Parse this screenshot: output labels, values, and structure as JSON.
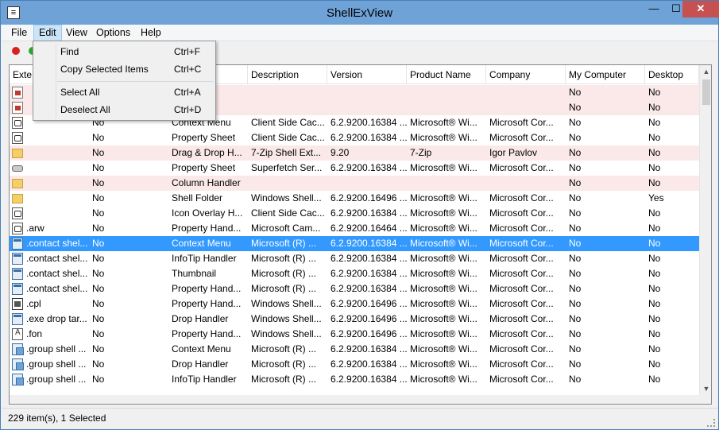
{
  "window": {
    "title": "ShellExView"
  },
  "titlebar": {
    "min_glyph": "—",
    "max_glyph": "☐",
    "close_glyph": "✕"
  },
  "menu": [
    "File",
    "Edit",
    "View",
    "Options",
    "Help"
  ],
  "edit_menu": [
    {
      "label": "Find",
      "shortcut": "Ctrl+F"
    },
    {
      "label": "Copy Selected Items",
      "shortcut": "Ctrl+C"
    },
    {
      "label": "Select All",
      "shortcut": "Ctrl+A"
    },
    {
      "label": "Deselect All",
      "shortcut": "Ctrl+D"
    }
  ],
  "columns": [
    "Exte",
    "",
    "",
    "Description",
    "Version",
    "Product Name",
    "Company",
    "My Computer",
    "Desktop"
  ],
  "rows": [
    {
      "icon": "red",
      "ext": "",
      "c2": "",
      "type": "ndler",
      "desc": "",
      "version": "",
      "product": "",
      "company": "",
      "mycomputer": "No",
      "desktop": "No",
      "style": "pink"
    },
    {
      "icon": "red",
      "ext": "",
      "c2": "",
      "type": "",
      "desc": "",
      "version": "",
      "product": "",
      "company": "",
      "mycomputer": "No",
      "desktop": "No",
      "style": "pink"
    },
    {
      "icon": "doc",
      "ext": "",
      "c2": "No",
      "type": "Context Menu",
      "desc": "Client Side Cac...",
      "version": "6.2.9200.16384 ...",
      "product": "Microsoft® Wi...",
      "company": "Microsoft Cor...",
      "mycomputer": "No",
      "desktop": "No",
      "style": ""
    },
    {
      "icon": "doc",
      "ext": "",
      "c2": "No",
      "type": "Property Sheet",
      "desc": "Client Side Cac...",
      "version": "6.2.9200.16384 ...",
      "product": "Microsoft® Wi...",
      "company": "Microsoft Cor...",
      "mycomputer": "No",
      "desktop": "No",
      "style": ""
    },
    {
      "icon": "folder",
      "ext": "",
      "c2": "No",
      "type": "Drag & Drop H...",
      "desc": "7-Zip Shell Ext...",
      "version": "9.20",
      "product": "7-Zip",
      "company": "Igor Pavlov",
      "mycomputer": "No",
      "desktop": "No",
      "style": "pink"
    },
    {
      "icon": "drive",
      "ext": "",
      "c2": "No",
      "type": "Property Sheet",
      "desc": "Superfetch Ser...",
      "version": "6.2.9200.16384 ...",
      "product": "Microsoft® Wi...",
      "company": "Microsoft Cor...",
      "mycomputer": "No",
      "desktop": "No",
      "style": ""
    },
    {
      "icon": "folder",
      "ext": "",
      "c2": "No",
      "type": "Column Handler",
      "desc": "",
      "version": "",
      "product": "",
      "company": "",
      "mycomputer": "No",
      "desktop": "No",
      "style": "pink"
    },
    {
      "icon": "folder",
      "ext": "",
      "c2": "No",
      "type": "Shell Folder",
      "desc": "Windows Shell...",
      "version": "6.2.9200.16496 ...",
      "product": "Microsoft® Wi...",
      "company": "Microsoft Cor...",
      "mycomputer": "No",
      "desktop": "Yes",
      "style": ""
    },
    {
      "icon": "doc",
      "ext": "",
      "c2": "No",
      "type": "Icon Overlay H...",
      "desc": "Client Side Cac...",
      "version": "6.2.9200.16384 ...",
      "product": "Microsoft® Wi...",
      "company": "Microsoft Cor...",
      "mycomputer": "No",
      "desktop": "No",
      "style": ""
    },
    {
      "icon": "doc",
      "ext": ".arw",
      "c2": "No",
      "type": "Property Hand...",
      "desc": "Microsoft Cam...",
      "version": "6.2.9200.16464 ...",
      "product": "Microsoft® Wi...",
      "company": "Microsoft Cor...",
      "mycomputer": "No",
      "desktop": "No",
      "style": ""
    },
    {
      "icon": "app",
      "ext": ".contact shel...",
      "c2": "No",
      "type": "Context Menu",
      "desc": "Microsoft (R) ...",
      "version": "6.2.9200.16384 ...",
      "product": "Microsoft® Wi...",
      "company": "Microsoft Cor...",
      "mycomputer": "No",
      "desktop": "No",
      "style": "selected"
    },
    {
      "icon": "app",
      "ext": ".contact shel...",
      "c2": "No",
      "type": "InfoTip Handler",
      "desc": "Microsoft (R) ...",
      "version": "6.2.9200.16384 ...",
      "product": "Microsoft® Wi...",
      "company": "Microsoft Cor...",
      "mycomputer": "No",
      "desktop": "No",
      "style": ""
    },
    {
      "icon": "app",
      "ext": ".contact shel...",
      "c2": "No",
      "type": "Thumbnail",
      "desc": "Microsoft (R) ...",
      "version": "6.2.9200.16384 ...",
      "product": "Microsoft® Wi...",
      "company": "Microsoft Cor...",
      "mycomputer": "No",
      "desktop": "No",
      "style": ""
    },
    {
      "icon": "app",
      "ext": ".contact shel...",
      "c2": "No",
      "type": "Property Hand...",
      "desc": "Microsoft (R) ...",
      "version": "6.2.9200.16384 ...",
      "product": "Microsoft® Wi...",
      "company": "Microsoft Cor...",
      "mycomputer": "No",
      "desktop": "No",
      "style": ""
    },
    {
      "icon": "cpl",
      "ext": ".cpl",
      "c2": "No",
      "type": "Property Hand...",
      "desc": "Windows Shell...",
      "version": "6.2.9200.16496 ...",
      "product": "Microsoft® Wi...",
      "company": "Microsoft Cor...",
      "mycomputer": "No",
      "desktop": "No",
      "style": ""
    },
    {
      "icon": "app",
      "ext": ".exe drop tar...",
      "c2": "No",
      "type": "Drop Handler",
      "desc": "Windows Shell...",
      "version": "6.2.9200.16496 ...",
      "product": "Microsoft® Wi...",
      "company": "Microsoft Cor...",
      "mycomputer": "No",
      "desktop": "No",
      "style": ""
    },
    {
      "icon": "font",
      "ext": ".fon",
      "c2": "No",
      "type": "Property Hand...",
      "desc": "Windows Shell...",
      "version": "6.2.9200.16496 ...",
      "product": "Microsoft® Wi...",
      "company": "Microsoft Cor...",
      "mycomputer": "No",
      "desktop": "No",
      "style": ""
    },
    {
      "icon": "group",
      "ext": ".group shell ...",
      "c2": "No",
      "type": "Context Menu",
      "desc": "Microsoft (R) ...",
      "version": "6.2.9200.16384 ...",
      "product": "Microsoft® Wi...",
      "company": "Microsoft Cor...",
      "mycomputer": "No",
      "desktop": "No",
      "style": ""
    },
    {
      "icon": "group",
      "ext": ".group shell ...",
      "c2": "No",
      "type": "Drop Handler",
      "desc": "Microsoft (R) ...",
      "version": "6.2.9200.16384 ...",
      "product": "Microsoft® Wi...",
      "company": "Microsoft Cor...",
      "mycomputer": "No",
      "desktop": "No",
      "style": ""
    },
    {
      "icon": "group",
      "ext": ".group shell ...",
      "c2": "No",
      "type": "InfoTip Handler",
      "desc": "Microsoft (R) ...",
      "version": "6.2.9200.16384 ...",
      "product": "Microsoft® Wi...",
      "company": "Microsoft Cor...",
      "mycomputer": "No",
      "desktop": "No",
      "style": ""
    }
  ],
  "status": {
    "text": "229 item(s), 1 Selected"
  },
  "colors": {
    "selection": "#3399ff",
    "highlight_row": "#fbe9e9",
    "titlebar": "#6fa3d8",
    "close_button": "#c75050"
  }
}
